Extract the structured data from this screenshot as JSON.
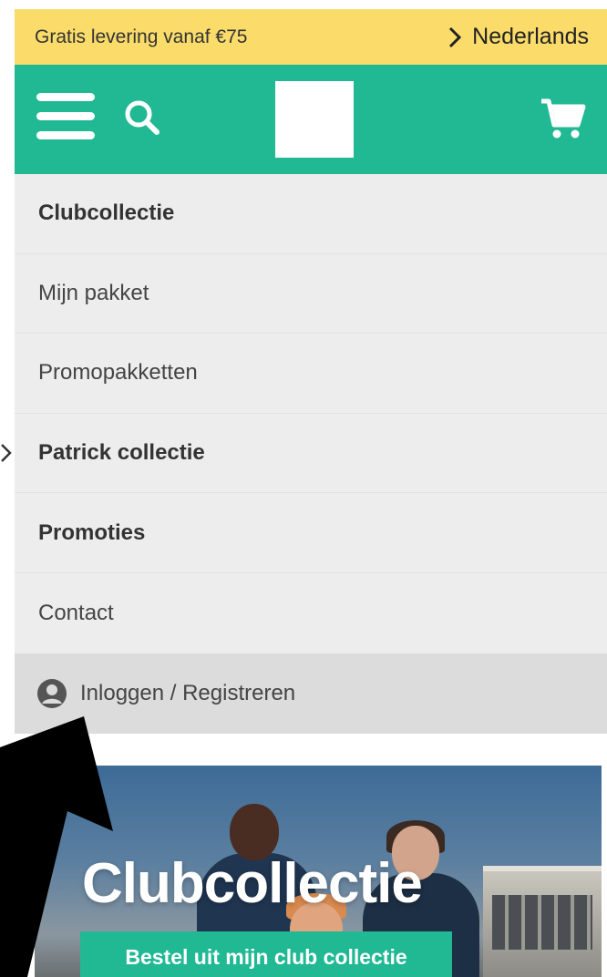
{
  "topbar": {
    "promo_text": "Gratis levering vanaf €75",
    "language_label": "Nederlands"
  },
  "header": {
    "menu_icon": "hamburger-icon",
    "search_icon": "search-icon",
    "cart_icon": "cart-icon"
  },
  "menu": {
    "items": [
      {
        "label": "Clubcollectie",
        "bold": true
      },
      {
        "label": "Mijn pakket",
        "bold": false
      },
      {
        "label": "Promopakketten",
        "bold": false
      },
      {
        "label": "Patrick collectie",
        "bold": true,
        "expandable": true
      },
      {
        "label": "Promoties",
        "bold": true
      },
      {
        "label": "Contact",
        "bold": false
      }
    ],
    "login_label": "Inloggen / Registreren",
    "login_icon": "user-circle-icon"
  },
  "hero": {
    "title": "Clubcollectie",
    "cta_label": "Bestel uit mijn club collectie"
  },
  "colors": {
    "topbar_bg": "#fbdc6b",
    "brand_green": "#21b894",
    "menu_bg": "#ededed",
    "login_bg": "#dcdcdc"
  }
}
